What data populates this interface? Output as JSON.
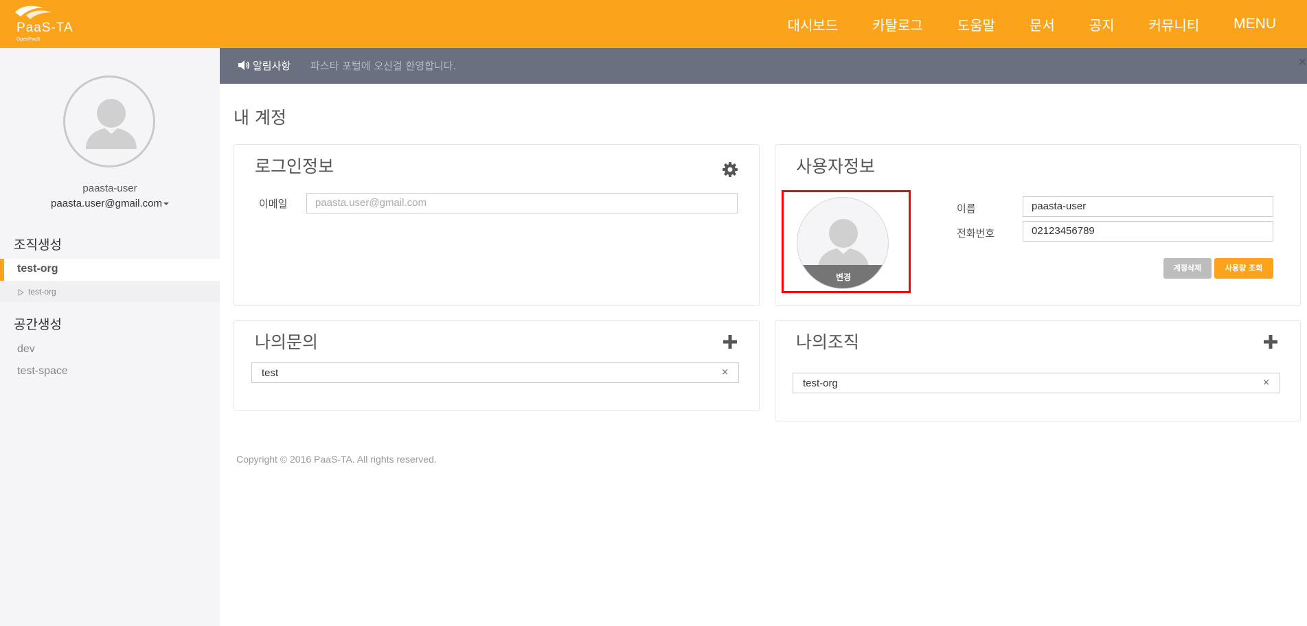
{
  "header": {
    "logo_text": "PaaS-TA",
    "logo_sub": "OpenPaaS",
    "nav": [
      "대시보드",
      "카탈로그",
      "도움말",
      "문서",
      "공지",
      "커뮤니티"
    ],
    "menu_label": "MENU",
    "accent_color": "#fba31b"
  },
  "sidebar": {
    "user_name": "paasta-user",
    "user_email": "paasta.user@gmail.com",
    "org_section": "조직생성",
    "org_selected": "test-org",
    "org_sub": "test-org",
    "space_section": "공간생성",
    "spaces": [
      "dev",
      "test-space"
    ]
  },
  "notice": {
    "label": "알림사항",
    "text": "파스타 포털에 오신걸 환영합니다.",
    "close": "×"
  },
  "page_title": "내 계정",
  "login_panel": {
    "title": "로그인정보",
    "email_label": "이메일",
    "email_placeholder": "paasta.user@gmail.com",
    "settings_icon": "gear-icon"
  },
  "user_panel": {
    "title": "사용자정보",
    "photo_change": "변경",
    "name_label": "이름",
    "name_value": "paasta-user",
    "phone_label": "전화번호",
    "phone_value": "02123456789",
    "delete_button": "계정삭제",
    "usage_button": "사용량 조회"
  },
  "inquiry_panel": {
    "title": "나의문의",
    "items": [
      "test"
    ],
    "add_icon": "plus-icon"
  },
  "org_panel": {
    "title": "나의조직",
    "items": [
      "test-org"
    ],
    "add_icon": "plus-icon"
  },
  "footer": {
    "copyright": "Copyright © 2016 PaaS-TA. All rights reserved."
  }
}
